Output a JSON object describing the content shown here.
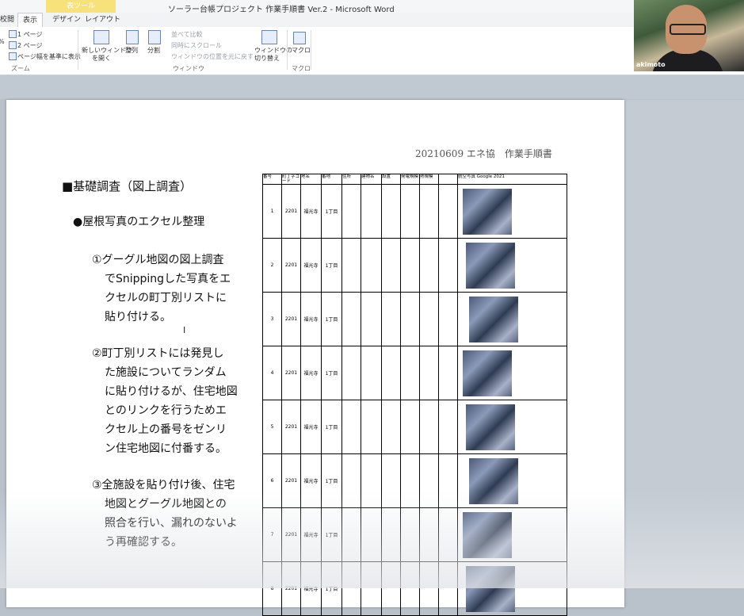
{
  "window": {
    "title": "ソーラー台帳プロジェクト 作業手順書 Ver.2 - Microsoft Word",
    "tools_tab": "表ツール"
  },
  "tabs": [
    "校閲",
    "表示",
    "デザイン",
    "レイアウト"
  ],
  "ribbon": {
    "zoom_group": {
      "one_page": "1 ページ",
      "two_pages": "2 ページ",
      "page_width": "ページ幅を基準に表示",
      "label": "ズーム",
      "pct": "%"
    },
    "window_group": {
      "new_window": [
        "新しいウィンドウ",
        "を開く"
      ],
      "arrange": "整列",
      "split": "分割",
      "side_by_side": "並べて比較",
      "sync_scroll": "同時にスクロール",
      "reset_position": "ウィンドウの位置を元に戻す",
      "switch": [
        "ウィンドウの",
        "切り替え"
      ],
      "label": "ウィンドウ"
    },
    "macro_group": {
      "macro": "マクロ",
      "label": "マクロ"
    }
  },
  "webcam": {
    "name": "akimoto"
  },
  "document": {
    "header": "20210609 エネ協　作業手順書",
    "heading": "■基礎調査（図上調査）",
    "subheading": "●屋根写真のエクセル整理",
    "items": [
      [
        "①グーグル地図の図上調査",
        "でSnippingした写真をエ",
        "クセルの町丁別リストに",
        "貼り付ける。"
      ],
      [
        "②町丁別リストには発見し",
        "た施設についてランダム",
        "に貼り付けるが、住宅地図",
        "とのリンクを行うためエ",
        "クセル上の番号をゼンリ",
        "ン住宅地図に付番する。"
      ],
      [
        "③全施設を貼り付け後、住宅",
        "地図とグーグル地図との",
        "照合を行い、漏れのないよ",
        "う再確認する。"
      ]
    ],
    "table": {
      "headers": [
        "番号",
        "町丁字コード",
        "地名",
        "番地",
        "住所",
        "建物名",
        "設置",
        "発電規模",
        "熱規模",
        "",
        "航空写真 Google 2021"
      ],
      "rows": [
        {
          "no": "1",
          "code": "2201",
          "place": "福光寺",
          "chome": "1丁目"
        },
        {
          "no": "2",
          "code": "2201",
          "place": "福光寺",
          "chome": "1丁目"
        },
        {
          "no": "3",
          "code": "2201",
          "place": "福光寺",
          "chome": "1丁目"
        },
        {
          "no": "4",
          "code": "2201",
          "place": "福光寺",
          "chome": "1丁目"
        },
        {
          "no": "5",
          "code": "2201",
          "place": "福光寺",
          "chome": "1丁目"
        },
        {
          "no": "6",
          "code": "2201",
          "place": "福光寺",
          "chome": "1丁目"
        },
        {
          "no": "7",
          "code": "2201",
          "place": "福光寺",
          "chome": "1丁目"
        },
        {
          "no": "8",
          "code": "2201",
          "place": "福光寺",
          "chome": "1丁目"
        }
      ]
    }
  }
}
